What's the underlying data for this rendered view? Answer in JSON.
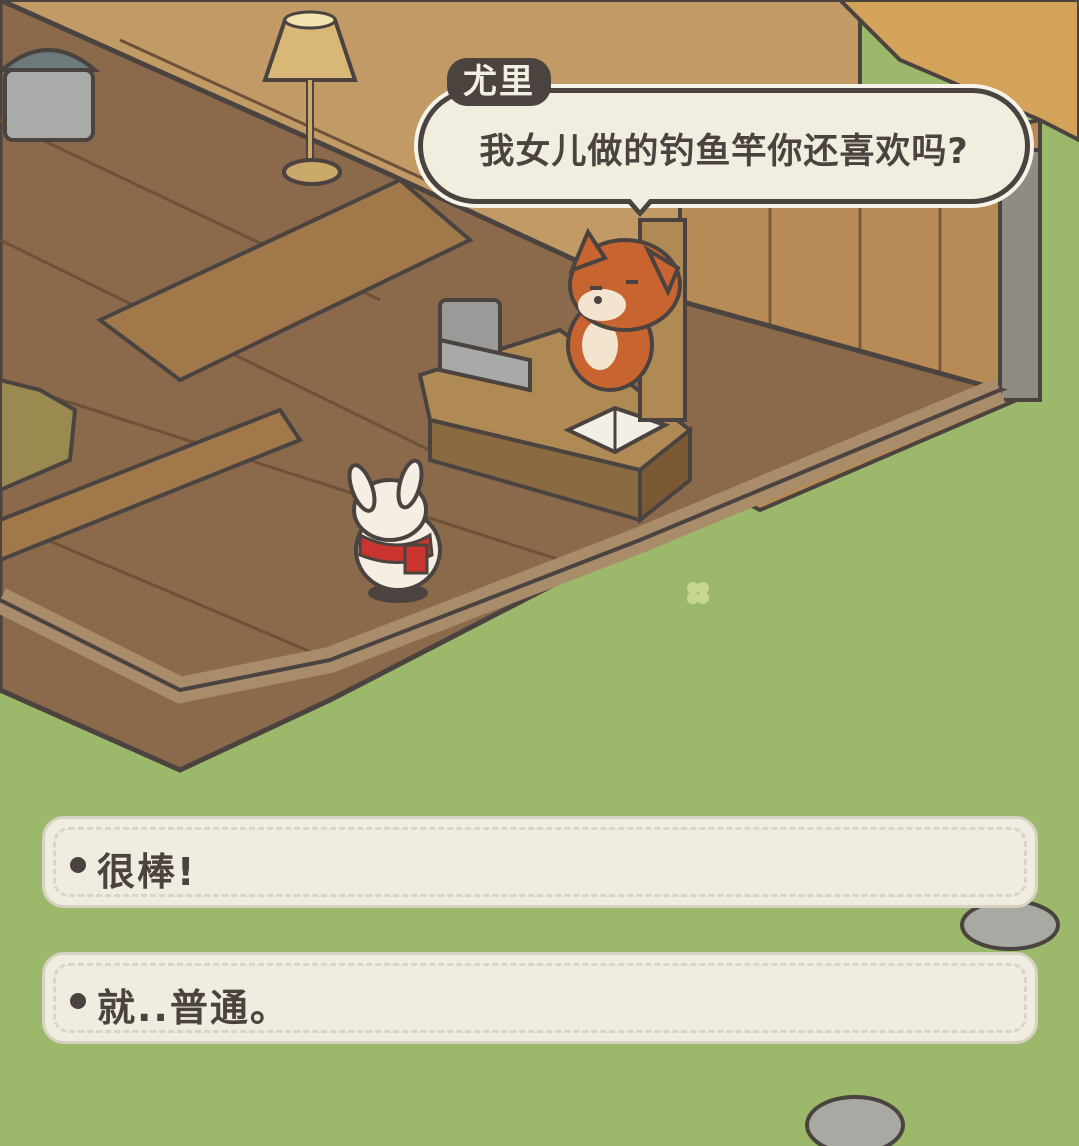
{
  "dialogue": {
    "speaker": "尤里",
    "line": "我女儿做的钓鱼竿你还喜欢吗?"
  },
  "choices": [
    {
      "label": "很棒!"
    },
    {
      "label": "就..普通。"
    }
  ],
  "colors": {
    "grass": "#9cb86a",
    "wood_floor": "#8a6a4a",
    "wood_wall": "#b08a5a",
    "dialog_bg": "#f1eee0",
    "ink": "#4a4340",
    "rabbit_scarf": "#c9342e",
    "fox": "#c8642f"
  }
}
